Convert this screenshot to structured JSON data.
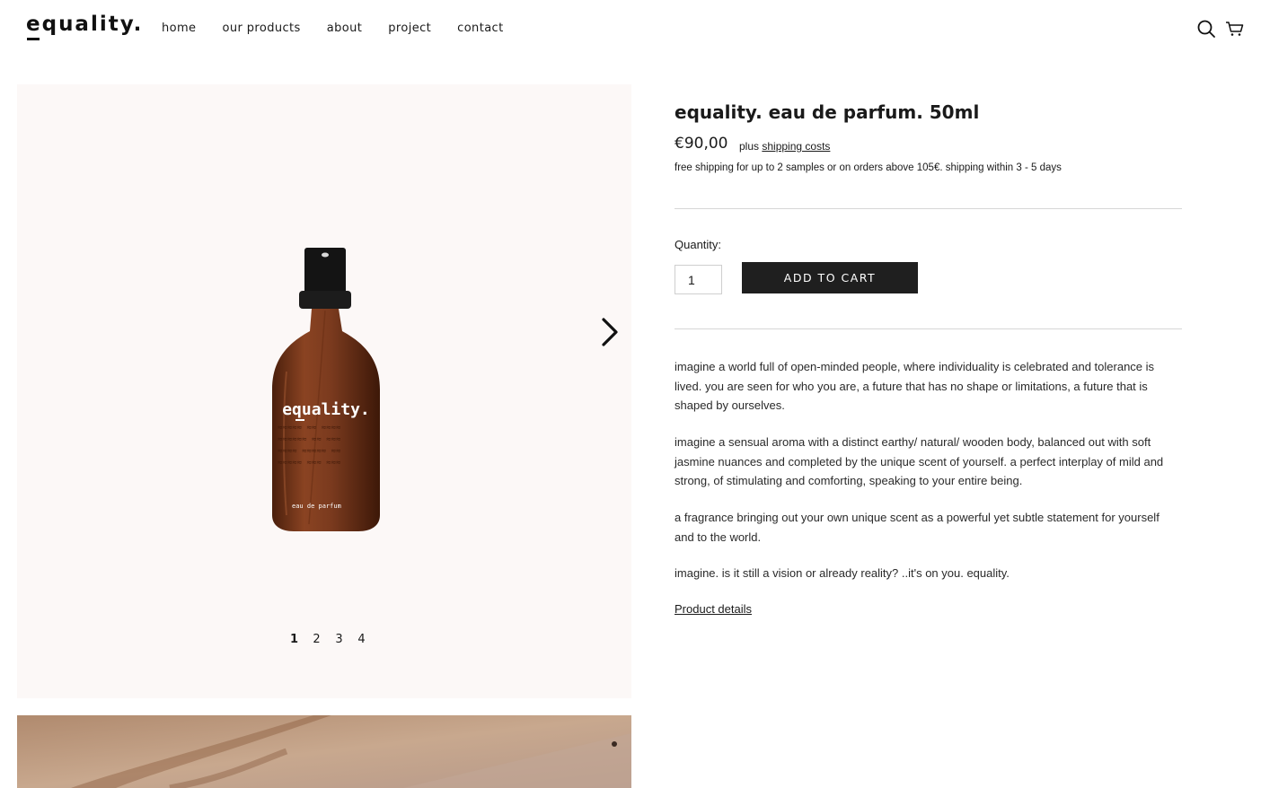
{
  "brand": {
    "logo_text": "equality."
  },
  "nav": {
    "items": [
      "home",
      "our products",
      "about",
      "project",
      "contact"
    ]
  },
  "header_icons": {
    "search": "search-icon",
    "cart": "cart-icon"
  },
  "gallery": {
    "bottle_label": "equality.",
    "bottle_sublabel": "eau de parfum",
    "pages": [
      "1",
      "2",
      "3",
      "4"
    ],
    "active_page": "1",
    "next_icon": "chevron-right-icon"
  },
  "product": {
    "title": "equality. eau de parfum. 50ml",
    "price": "€90,00",
    "price_note_prefix": "plus",
    "shipping_link": "shipping costs",
    "shipping_info": "free shipping for up to 2 samples or on orders above 105€. shipping within 3 - 5 days",
    "quantity_label": "Quantity:",
    "quantity_value": "1",
    "add_to_cart": "ADD TO CART",
    "description": [
      "imagine a world full of open-minded people, where individuality is celebrated and tolerance is lived. you are seen for who you are, a future that has no shape or limitations, a future that is shaped by ourselves.",
      "imagine a sensual aroma with a distinct earthy/ natural/ wooden body, balanced out with soft jasmine nuances and completed by the unique scent of yourself. a perfect interplay of mild and strong, of stimulating and comforting, speaking to your entire being.",
      "a fragrance bringing out your own unique scent as a powerful yet subtle statement for yourself and to the world.",
      "imagine. is it still a vision or already reality? ..it's on you. equality."
    ],
    "details_link": "Product details"
  },
  "colors": {
    "accent": "#1f1f1f",
    "gallery_bg": "#fcf8f7",
    "bottle": "#7a3a1e"
  }
}
